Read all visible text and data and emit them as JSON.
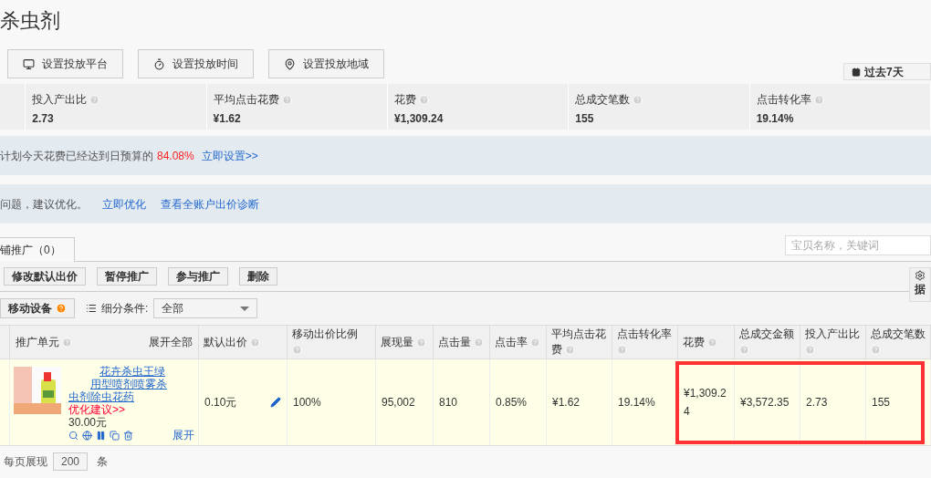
{
  "page_title": "杀虫剂",
  "setting_buttons": [
    {
      "label": "设置投放平台",
      "kind": "platform"
    },
    {
      "label": "设置投放时间",
      "kind": "time"
    },
    {
      "label": "设置投放地域",
      "kind": "region"
    }
  ],
  "date_range": "过去7天",
  "stats": [
    {
      "label": "投入产出比",
      "value": "2.73"
    },
    {
      "label": "平均点击花费",
      "value": "¥1.62"
    },
    {
      "label": "花费",
      "value": "¥1,309.24"
    },
    {
      "label": "总成交笔数",
      "value": "155"
    },
    {
      "label": "点击转化率",
      "value": "19.14%"
    }
  ],
  "budget_notice": {
    "text": "计划今天花费已经达到日预算的",
    "percent": "84.08%",
    "link": "立即设置>>"
  },
  "bid_notice": {
    "text": "问题，建议优化。",
    "links": [
      "立即优化",
      "查看全账户出价诊断"
    ]
  },
  "tabs": [
    {
      "label": "铺推广（0）",
      "selected": true
    }
  ],
  "search": {
    "placeholder": "宝贝名称，关键词"
  },
  "actions": [
    "修改默认出价",
    "暂停推广",
    "参与推广",
    "删除"
  ],
  "settings_button": "据",
  "device_button": "移动设备",
  "filter": {
    "label": "细分条件:",
    "value": "全部"
  },
  "table": {
    "columns": [
      "推广单元",
      "默认出价",
      "移动出价比例",
      "展现量",
      "点击量",
      "点击率",
      "平均点击花费",
      "点击转化率",
      "花费",
      "总成交金额",
      "投入产出比",
      "总成交笔数"
    ],
    "expand_all": "展开全部",
    "rows": [
      {
        "cells": [
          {
            "kind": "unit",
            "title_lines": [
              "花卉杀虫王绿",
              "用型喷剂喷雾杀",
              "虫剂除虫花药"
            ],
            "suggestion": "优化建议>>",
            "price": "30.00元",
            "expand": "展开"
          },
          {
            "kind": "bid",
            "text": "0.10元"
          },
          {
            "kind": "text",
            "text": "100%"
          },
          {
            "kind": "text",
            "text": "95,002"
          },
          {
            "kind": "text",
            "text": "810"
          },
          {
            "kind": "text",
            "text": "0.85%"
          },
          {
            "kind": "text",
            "text": "¥1.62"
          },
          {
            "kind": "text",
            "text": "19.14%"
          },
          {
            "kind": "text",
            "text": "¥1,309.24"
          },
          {
            "kind": "text",
            "text": "¥3,572.35"
          },
          {
            "kind": "text",
            "text": "2.73"
          },
          {
            "kind": "text",
            "text": "155"
          }
        ]
      }
    ]
  },
  "page_size": {
    "label": "每页展现",
    "value": "200",
    "unit": "条"
  }
}
